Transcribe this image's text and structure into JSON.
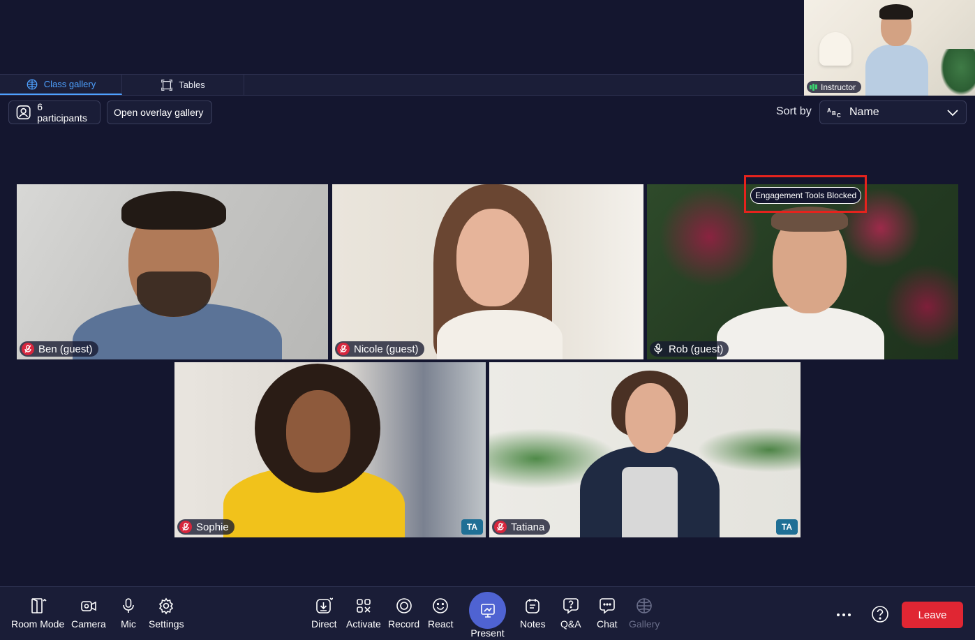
{
  "tabs": [
    {
      "label": "Class gallery",
      "icon": "grid-globe-icon",
      "active": true
    },
    {
      "label": "Tables",
      "icon": "tables-icon",
      "active": false
    }
  ],
  "instructor": {
    "name": "Instructor",
    "status_color": "#3bd16f"
  },
  "toolbar": {
    "participants_label": "6 participants",
    "overlay_label": "Open overlay gallery",
    "sort_label": "Sort by",
    "sort_value": "Name"
  },
  "participants": [
    {
      "name": "Ben (guest)",
      "mic": "muted"
    },
    {
      "name": "Nicole (guest)",
      "mic": "muted"
    },
    {
      "name": "Rob (guest)",
      "mic": "other",
      "badge": "Engagement Tools Blocked"
    },
    {
      "name": "Sophie",
      "mic": "muted",
      "role": "TA"
    },
    {
      "name": "Tatiana",
      "mic": "muted",
      "role": "TA"
    }
  ],
  "bottom_bar": {
    "room_mode": "Room Mode",
    "camera": "Camera",
    "mic": "Mic",
    "settings": "Settings",
    "direct": "Direct",
    "activate": "Activate",
    "record": "Record",
    "react": "React",
    "present": "Present",
    "notes": "Notes",
    "qa": "Q&A",
    "chat": "Chat",
    "gallery": "Gallery",
    "leave": "Leave"
  },
  "colors": {
    "background": "#14162f",
    "accent": "#4ea1ff",
    "present": "#4f63d2",
    "leave": "#e02633",
    "highlight": "#e5231d",
    "ta": "#1f6f95"
  }
}
